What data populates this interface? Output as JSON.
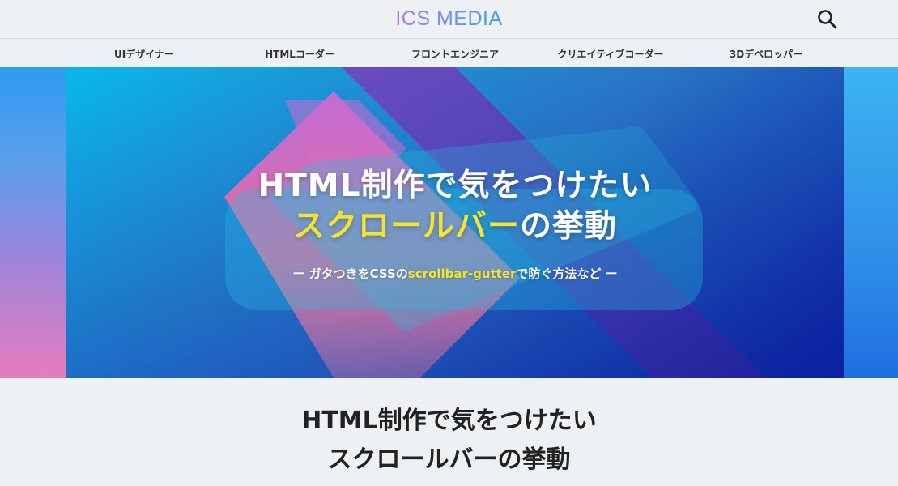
{
  "header": {
    "logo": "ICS MEDIA",
    "search_icon": "search-icon"
  },
  "nav": {
    "items": [
      {
        "label": "UIデザイナー"
      },
      {
        "label": "HTMLコーダー"
      },
      {
        "label": "フロントエンジニア"
      },
      {
        "label": "クリエイティブコーダー"
      },
      {
        "label": "3Dデベロッパー"
      }
    ]
  },
  "hero": {
    "line1": "HTML制作で気をつけたい",
    "line2_highlight": "スクロールバー",
    "line2_rest": "の挙動",
    "sub_prefix": "ー ガタつきをCSSの",
    "sub_highlight": "scrollbar-gutter",
    "sub_suffix": "で防ぐ方法など ー",
    "colors": {
      "accent_yellow": "#f5e52a"
    }
  },
  "article": {
    "title_line1": "HTML制作で気をつけたい",
    "title_line2": "スクロールバーの挙動"
  }
}
